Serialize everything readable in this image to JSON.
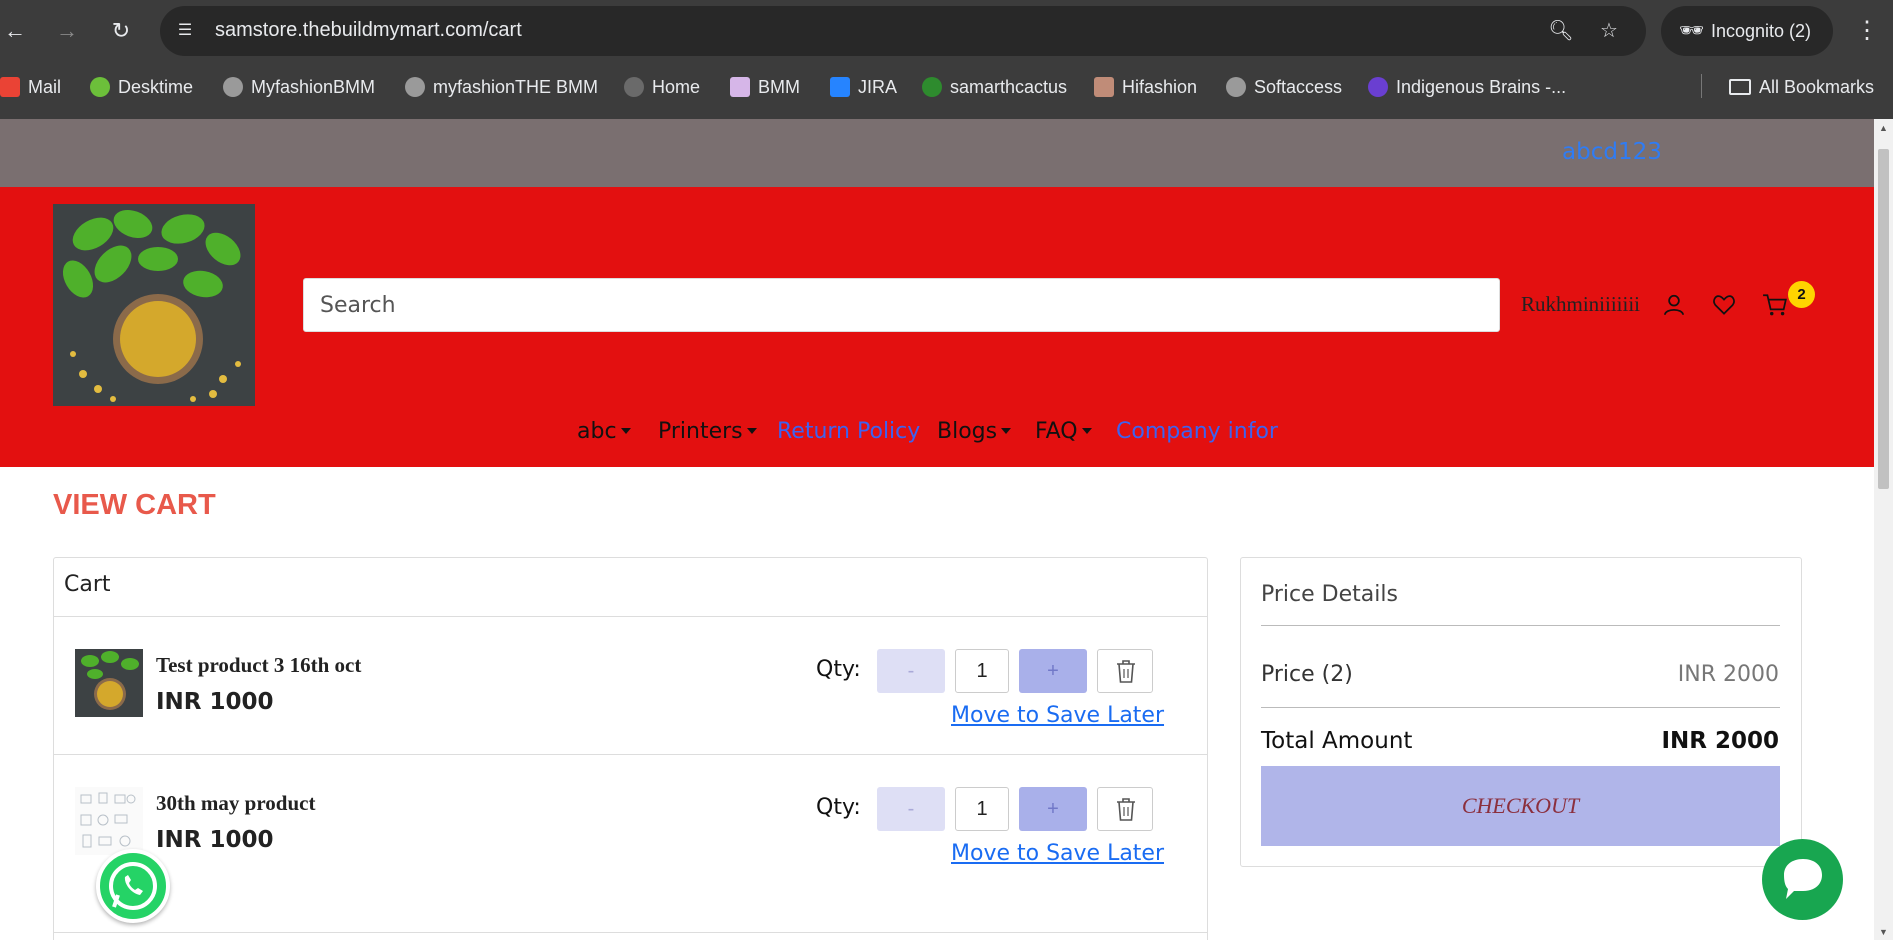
{
  "browser": {
    "url": "samstore.thebuildmymart.com/cart",
    "incognito_label": "Incognito (2)",
    "bookmarks": [
      {
        "label": "Mail"
      },
      {
        "label": "Desktime"
      },
      {
        "label": "MyfashionBMM"
      },
      {
        "label": "myfashionTHE BMM"
      },
      {
        "label": "Home"
      },
      {
        "label": "BMM"
      },
      {
        "label": "JIRA"
      },
      {
        "label": "samarthcactus"
      },
      {
        "label": "Hifashion"
      },
      {
        "label": "Softaccess"
      },
      {
        "label": "Indigenous Brains -..."
      }
    ],
    "all_bookmarks_label": "All Bookmarks"
  },
  "topbar": {
    "link": "abcd123"
  },
  "header": {
    "search_placeholder": "Search",
    "username": "Rukhminiiiiiii",
    "cart_count": "2"
  },
  "menu": [
    {
      "label": "abc",
      "dropdown": true
    },
    {
      "label": "Printers",
      "dropdown": true
    },
    {
      "label": "Return Policy",
      "dropdown": false
    },
    {
      "label": "Blogs",
      "dropdown": true
    },
    {
      "label": "FAQ",
      "dropdown": true
    },
    {
      "label": "Company infor",
      "dropdown": false
    }
  ],
  "page_title": "VIEW CART",
  "cart": {
    "title": "Cart",
    "qty_label": "Qty:",
    "minus": "-",
    "plus": "+",
    "save_later": "Move to Save Later",
    "items": [
      {
        "name": "Test product 3 16th oct",
        "price": "INR 1000",
        "qty": "1"
      },
      {
        "name": "30th may product",
        "price": "INR 1000",
        "qty": "1"
      }
    ]
  },
  "price_details": {
    "title": "Price Details",
    "price_label": "Price (2)",
    "price_value": "INR 2000",
    "total_label": "Total Amount",
    "total_value": "INR 2000",
    "checkout_label": "CHECKOUT"
  },
  "colors": {
    "header_red": "#e31010",
    "topbar_gray": "#7a6f70",
    "title_coral": "#e8594b",
    "checkout_bg": "#b0b5e9",
    "link_blue": "#1a6cf2"
  }
}
